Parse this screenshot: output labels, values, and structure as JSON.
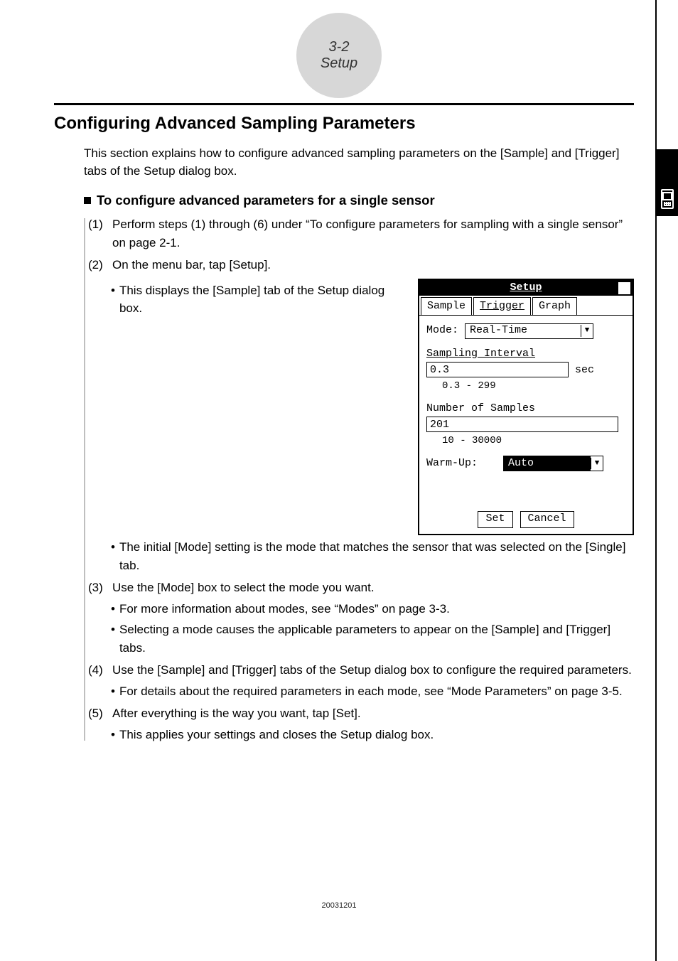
{
  "header": {
    "page_num": "3-2",
    "section": "Setup"
  },
  "title": "Configuring Advanced Sampling Parameters",
  "intro": "This section explains how to configure advanced sampling parameters on the [Sample] and [Trigger] tabs of the Setup dialog box.",
  "sub_title": "To configure advanced parameters for a single sensor",
  "steps": {
    "s1_num": "(1)",
    "s1_text": "Perform steps (1) through (6) under “To configure parameters for sampling with a single sensor” on page 2-1.",
    "s2_num": "(2)",
    "s2_text": "On the menu bar, tap [Setup].",
    "s2_b1": "This displays the [Sample] tab of the Setup dialog box.",
    "s2_b2": "The initial [Mode] setting is the mode that matches the sensor that was selected on the [Single] tab.",
    "s3_num": "(3)",
    "s3_text": "Use the [Mode] box to select the mode you want.",
    "s3_b1": "For more information about modes, see “Modes” on page 3-3.",
    "s3_b2": "Selecting a mode causes the applicable parameters to appear on the [Sample] and [Trigger] tabs.",
    "s4_num": "(4)",
    "s4_text": "Use the [Sample] and [Trigger] tabs of the Setup dialog box to configure the required parameters.",
    "s4_b1": "For details about the required parameters in each mode, see “Mode Parameters” on page 3-5.",
    "s5_num": "(5)",
    "s5_text": "After everything is the way you want, tap [Set].",
    "s5_b1": "This applies your settings and closes the Setup dialog box."
  },
  "dialog": {
    "title": "Setup",
    "close_glyph": "✖",
    "tabs": {
      "t1": "Sample",
      "t2": "Trigger",
      "t3": "Graph"
    },
    "mode_label": "Mode:",
    "mode_value": "Real-Time",
    "interval_label": "Sampling Interval",
    "interval_value": "0.3",
    "interval_unit": "sec",
    "interval_range": "0.3 - 299",
    "samples_label": "Number of Samples",
    "samples_value": "201",
    "samples_range": "10 - 30000",
    "warmup_label": "Warm-Up:",
    "warmup_value": "Auto",
    "btn_set": "Set",
    "btn_cancel": "Cancel"
  },
  "footer_code": "20031201"
}
